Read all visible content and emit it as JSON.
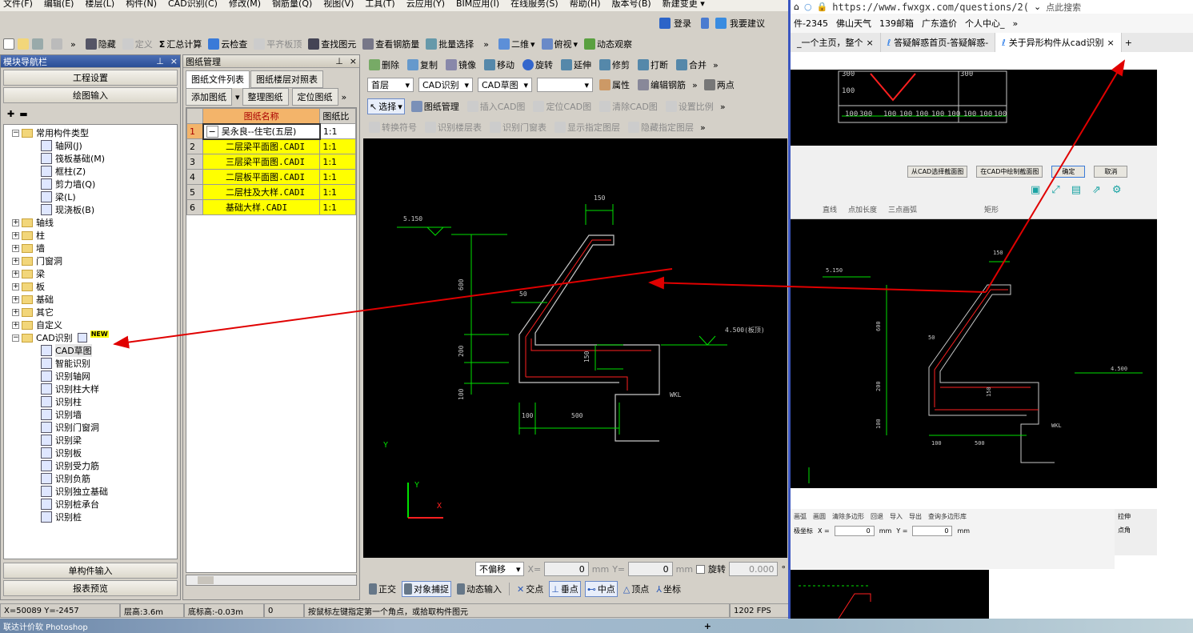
{
  "menu": [
    "文件(F)",
    "编辑(E)",
    "楼层(L)",
    "构件(N)",
    "CAD识别(C)",
    "修改(M)",
    "钢筋量(Q)",
    "视图(V)",
    "工具(T)",
    "云应用(Y)",
    "BIM应用(I)",
    "在线服务(S)",
    "帮助(H)",
    "版本号(B)",
    "新建变更 ▾"
  ],
  "login": {
    "login": "登录",
    "suggest": "我要建议"
  },
  "toolbar1": {
    "hide": "隐藏",
    "define": "定义",
    "calc": "汇总计算",
    "cloud": "云检查",
    "flat": "平齐板顶",
    "find": "查找图元",
    "view_rebar": "查看钢筋量",
    "batch": "批量选择",
    "dim": "二维",
    "view": "俯视",
    "dyn": "动态观察"
  },
  "nav": {
    "title": "模块导航栏",
    "project": "工程设置",
    "draw": "绘图输入",
    "single": "单构件输入",
    "report": "报表预览"
  },
  "tree": {
    "common": "常用构件类型",
    "items": [
      "轴网(J)",
      "筏板基础(M)",
      "框柱(Z)",
      "剪力墙(Q)",
      "梁(L)",
      "现浇板(B)"
    ],
    "folders": [
      "轴线",
      "柱",
      "墙",
      "门窗洞",
      "梁",
      "板",
      "基础",
      "其它",
      "自定义"
    ],
    "cad": "CAD识别",
    "new_badge": "NEW",
    "cad_items": [
      "CAD草图",
      "智能识别",
      "识别轴网",
      "识别柱大样",
      "识别柱",
      "识别墙",
      "识别门窗洞",
      "识别梁",
      "识别板",
      "识别受力筋",
      "识别负筋",
      "识别独立基础",
      "识别桩承台",
      "识别桩"
    ]
  },
  "drawing_mgr": {
    "title": "图纸管理",
    "tab1": "图纸文件列表",
    "tab2": "图纸楼层对照表",
    "add": "添加图纸",
    "organize": "整理图纸",
    "locate": "定位图纸",
    "col_name": "图纸名称",
    "col_ratio": "图纸比",
    "rows": [
      {
        "no": "1",
        "name": "吴永良--住宅(五层)",
        "ratio": "1:1"
      },
      {
        "no": "2",
        "name": "二层梁平面图.CADI",
        "ratio": "1:1"
      },
      {
        "no": "3",
        "name": "三层梁平面图.CADI",
        "ratio": "1:1"
      },
      {
        "no": "4",
        "name": "二层板平面图.CADI",
        "ratio": "1:1"
      },
      {
        "no": "5",
        "name": "二层柱及大样.CADI",
        "ratio": "1:1"
      },
      {
        "no": "6",
        "name": "基础大样.CADI",
        "ratio": "1:1"
      }
    ]
  },
  "edit_toolbar": {
    "delete": "删除",
    "copy": "复制",
    "mirror": "镜像",
    "move": "移动",
    "rotate": "旋转",
    "extend": "延伸",
    "trim": "修剪",
    "break": "打断",
    "merge": "合并"
  },
  "layer_bar": {
    "floor": "首层",
    "cad_id": "CAD识别",
    "cad_sketch": "CAD草图",
    "prop": "属性",
    "edit_rebar": "编辑钢筋",
    "two_pt": "两点"
  },
  "cad_bar": {
    "select": "选择",
    "mgr": "图纸管理",
    "insert": "插入CAD图",
    "locate": "定位CAD图",
    "clear": "清除CAD图",
    "scale": "设置比例"
  },
  "cad_bar2": {
    "convert": "转换符号",
    "floor_tbl": "识别楼层表",
    "door_tbl": "识别门窗表",
    "show_layer": "显示指定图层",
    "hide_layer": "隐藏指定图层"
  },
  "drawing": {
    "d150": "150",
    "elev1": "5.150",
    "d600": "600",
    "d50": "50",
    "d200": "200",
    "d100v": "100",
    "d150b": "150",
    "elev2": "4.500(板顶)",
    "wkl": "WKL",
    "d100": "100",
    "d500": "500",
    "y": "Y",
    "x": "X"
  },
  "bottom_bar": {
    "offset": "不偏移",
    "xlabel": "X=",
    "xval": "0",
    "ylabel": "Y=",
    "yval": "0",
    "mm": "mm",
    "rot": "旋转",
    "rotval": "0.000",
    "deg": "°"
  },
  "snap_bar": {
    "ortho": "正交",
    "snap": "对象捕捉",
    "dyn": "动态输入",
    "inter": "交点",
    "perp": "垂点",
    "mid": "中点",
    "vertex": "顶点",
    "coord": "坐标"
  },
  "status": {
    "coords": "X=50089 Y=-2457",
    "height": "层高:3.6m",
    "base": "底标高:-0.03m",
    "zero": "0",
    "hint": "按鼠标左键指定第一个角点，或拾取构件图元",
    "fps": "1202 FPS"
  },
  "taskbar": {
    "app": "联达计价软  Photoshop"
  },
  "browser": {
    "url": "https://www.fwxgx.com/questions/2(",
    "right": "点此搜索",
    "bookmarks": [
      "件-2345",
      "佛山天气",
      "139邮箱",
      "广东造价",
      "个人中心_"
    ],
    "tabs": [
      "_一个主页，整个",
      "答疑解惑首页-答疑解惑-",
      "关于异形构件从cad识别"
    ],
    "dlg_buttons": [
      "从CAD选择截面图",
      "在CAD中绘制截面图",
      "确定",
      "取消"
    ],
    "inner_tools": [
      "直线",
      "点加长度",
      "三点画弧",
      "矩形"
    ],
    "inner_bottom": [
      "画弧",
      "画圆",
      "清除多边形",
      "回退",
      "导入",
      "导出",
      "查询多边形库"
    ],
    "coord_row": {
      "label": "极坐标",
      "x": "X =",
      "y": "Y =",
      "xv": "0",
      "yv": "0",
      "mm": "mm"
    },
    "side": [
      "拉伸",
      "点角"
    ],
    "d150": "150",
    "elev1": "5.150",
    "d600": "600",
    "d50": "50",
    "d200": "200",
    "d100v": "100",
    "d150b": "150",
    "elev2": "4.500",
    "wkl": "WKL",
    "d100": "100",
    "d500": "500",
    "top": [
      "300",
      "100",
      "300",
      "100"
    ],
    "grid_nums": [
      "100",
      "300",
      "100",
      "100",
      "100",
      "100",
      "100",
      "100",
      "100",
      "100"
    ]
  }
}
